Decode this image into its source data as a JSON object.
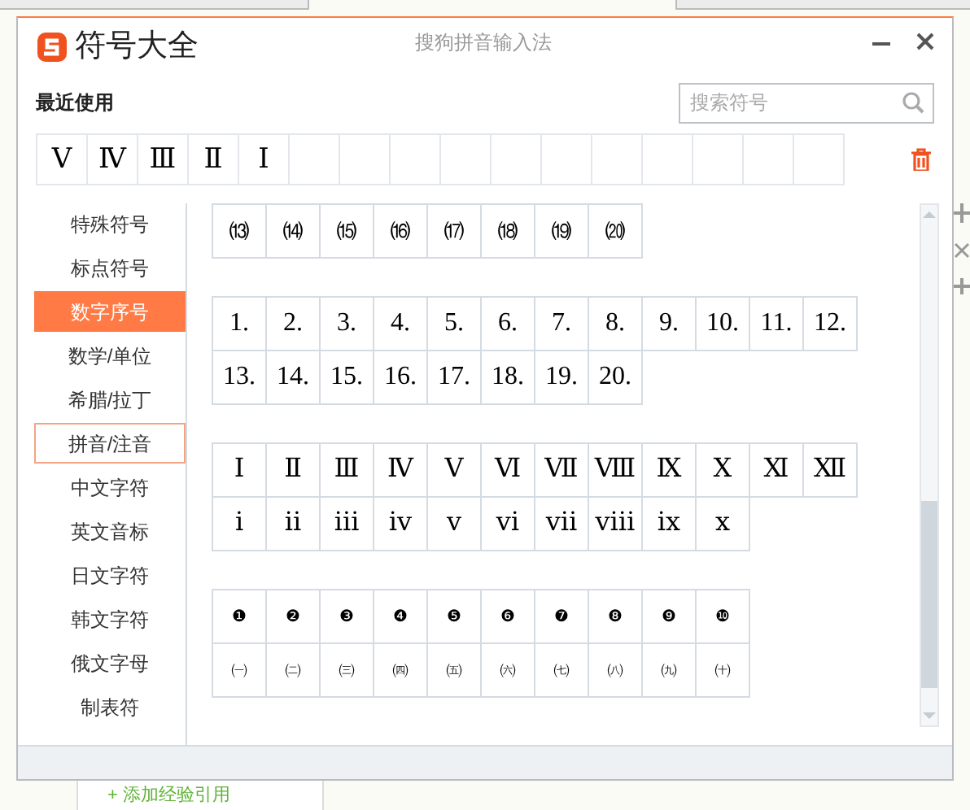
{
  "window": {
    "title": "符号大全",
    "subtitle": "搜狗拼音输入法"
  },
  "recent": {
    "label": "最近使用",
    "items": [
      "Ⅴ",
      "Ⅳ",
      "Ⅲ",
      "Ⅱ",
      "Ⅰ"
    ]
  },
  "search": {
    "placeholder": "搜索符号"
  },
  "sidebar": {
    "items": [
      {
        "label": "特殊符号",
        "selected": false,
        "hovered": false
      },
      {
        "label": "标点符号",
        "selected": false,
        "hovered": false
      },
      {
        "label": "数字序号",
        "selected": true,
        "hovered": false
      },
      {
        "label": "数学/单位",
        "selected": false,
        "hovered": false
      },
      {
        "label": "希腊/拉丁",
        "selected": false,
        "hovered": false
      },
      {
        "label": "拼音/注音",
        "selected": false,
        "hovered": true
      },
      {
        "label": "中文字符",
        "selected": false,
        "hovered": false
      },
      {
        "label": "英文音标",
        "selected": false,
        "hovered": false
      },
      {
        "label": "日文字符",
        "selected": false,
        "hovered": false
      },
      {
        "label": "韩文字符",
        "selected": false,
        "hovered": false
      },
      {
        "label": "俄文字母",
        "selected": false,
        "hovered": false
      },
      {
        "label": "制表符",
        "selected": false,
        "hovered": false
      }
    ]
  },
  "groups": [
    {
      "kind": "paren",
      "rows": [
        [
          "⒀",
          "⒁",
          "⒂",
          "⒃",
          "⒄",
          "⒅",
          "⒆",
          "⒇"
        ]
      ]
    },
    {
      "kind": "period",
      "rows": [
        [
          "1.",
          "2.",
          "3.",
          "4.",
          "5.",
          "6.",
          "7.",
          "8.",
          "9.",
          "10.",
          "11.",
          "12."
        ],
        [
          "13.",
          "14.",
          "15.",
          "16.",
          "17.",
          "18.",
          "19.",
          "20."
        ]
      ]
    },
    {
      "kind": "roman",
      "rows": [
        [
          "Ⅰ",
          "Ⅱ",
          "Ⅲ",
          "Ⅳ",
          "Ⅴ",
          "Ⅵ",
          "Ⅶ",
          "Ⅷ",
          "Ⅸ",
          "Ⅹ",
          "Ⅺ",
          "Ⅻ"
        ],
        [
          "ⅰ",
          "ⅱ",
          "ⅲ",
          "ⅳ",
          "ⅴ",
          "ⅵ",
          "ⅶ",
          "ⅷ",
          "ⅸ",
          "ⅹ"
        ]
      ]
    },
    {
      "kind": "circled",
      "rows": [
        [
          "❶",
          "❷",
          "❸",
          "❹",
          "❺",
          "❻",
          "❼",
          "❽",
          "❾",
          "❿"
        ],
        [
          "㈠",
          "㈡",
          "㈢",
          "㈣",
          "㈤",
          "㈥",
          "㈦",
          "㈧",
          "㈨",
          "㈩"
        ]
      ]
    }
  ],
  "page": {
    "add_link": "+ 添加经验引用"
  }
}
